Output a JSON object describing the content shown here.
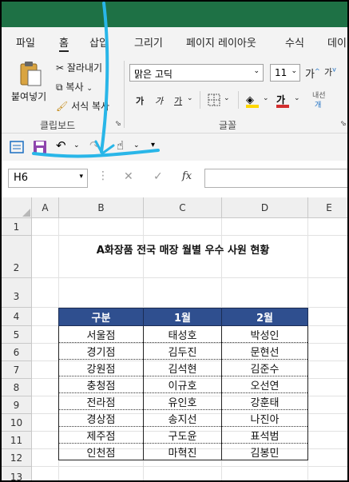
{
  "tabs": [
    "파일",
    "홈",
    "삽입",
    "그리기",
    "페이지 레이아웃",
    "수식",
    "데이"
  ],
  "active_tab": "홈",
  "ribbon": {
    "paste": "붙여넣기",
    "cut": "잘라내기",
    "copy": "복사",
    "format_painter": "서식 복사",
    "clipboard_group": "클립보드",
    "font_group": "글꼴",
    "font_name": "맑은 고딕",
    "font_size": "11",
    "wrap": "내선",
    "bold": "가",
    "italic": "가",
    "underline": "가"
  },
  "formula_bar": {
    "name_box": "H6",
    "fx": "fx",
    "formula": ""
  },
  "columns": [
    "A",
    "B",
    "C",
    "D",
    "E"
  ],
  "rows": [
    "1",
    "2",
    "3",
    "4",
    "5",
    "6",
    "7",
    "8",
    "9",
    "10",
    "11",
    "12",
    "13"
  ],
  "sheet": {
    "title": "A화장품 전국 매장 월별 우수 사원 현황",
    "headers": [
      "구분",
      "1월",
      "2월"
    ],
    "data": [
      [
        "서울점",
        "태성호",
        "박성인"
      ],
      [
        "경기점",
        "김두진",
        "문현선"
      ],
      [
        "강원점",
        "김석현",
        "김준수"
      ],
      [
        "충청점",
        "이규호",
        "오선연"
      ],
      [
        "전라점",
        "유인호",
        "강훈태"
      ],
      [
        "경상점",
        "송지선",
        "나진아"
      ],
      [
        "제주점",
        "구도윤",
        "표석범"
      ],
      [
        "인천점",
        "마혁진",
        "김봉민"
      ]
    ]
  },
  "colors": {
    "header_fill": "#2f4f8f",
    "annotation": "#29b6e8"
  }
}
